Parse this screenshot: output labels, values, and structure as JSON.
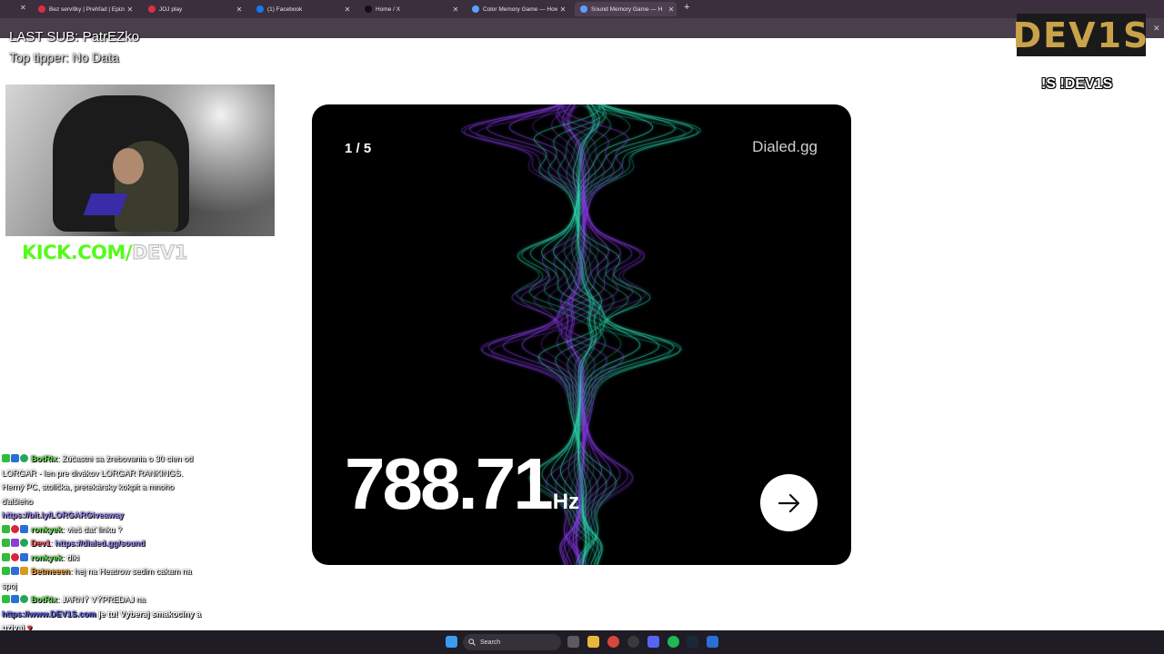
{
  "browser": {
    "tabs": [
      {
        "title": "Bez servítky | Prehľad | Epizódy",
        "color": "#d9304a"
      },
      {
        "title": "JOJ play",
        "color": "#d9304a"
      },
      {
        "title": "(1) Facebook",
        "color": "#1877f2"
      },
      {
        "title": "Home / X",
        "color": "#111111"
      },
      {
        "title": "Color Memory Game — How W",
        "color": "#5aa0ff"
      },
      {
        "title": "Sound Memory Game — H",
        "color": "#5aa0ff"
      }
    ],
    "new_tab": "+"
  },
  "overlay": {
    "last_sub": "LAST SUB: PatrEZko",
    "top_tipper": "Top tipper: No Data",
    "logo": "DEV1S",
    "command": "!S !DEV1S",
    "kick_url_green": "KICK.COM/",
    "kick_url_white": "DEV1"
  },
  "chat": {
    "messages": [
      {
        "badges": [
          "b-green",
          "b-blue",
          "b-check"
        ],
        "user": "BotRix",
        "user_class": "u-green",
        "sep": ": ",
        "text": "Zúčastni sa žrebovania o 30 cien od LORGAR - len pre divákov LORGAR RANKINGS. Herný PC, stolička, pretekársky kokpit a mnoho ďalšieho",
        "link": "https://bit.ly/LORGARGiveaway"
      },
      {
        "badges": [
          "b-green",
          "b-red",
          "b-blue"
        ],
        "user": "ronkyek",
        "user_class": "u-green",
        "sep": ": ",
        "text": "vieš dať linku ?",
        "link": ""
      },
      {
        "badges": [
          "b-green",
          "b-mic",
          "b-check"
        ],
        "user": "Dev1",
        "user_class": "u-red",
        "sep": ": ",
        "text": "",
        "link": "https://dialed.gg/sound"
      },
      {
        "badges": [
          "b-green",
          "b-red",
          "b-blue"
        ],
        "user": "ronkyek",
        "user_class": "u-green",
        "sep": ": ",
        "text": "diki",
        "link": ""
      },
      {
        "badges": [
          "b-green",
          "b-blue",
          "b-crown"
        ],
        "user": "Betmeeen",
        "user_class": "u-orange",
        "sep": ": ",
        "text": "hej na Heatrow sedim cakam na spoj",
        "link": ""
      },
      {
        "badges": [
          "b-green",
          "b-blue",
          "b-check"
        ],
        "user": "BotRix",
        "user_class": "u-green",
        "sep": ": ",
        "text": "JARNÝ VÝPREDAJ na",
        "link": ""
      }
    ],
    "tail_link": "https://www.DEV1S.com",
    "tail_text": " je tu! Vyberaj smakociny a uzivaj",
    "tail_heart": "♥"
  },
  "game": {
    "round": "1 / 5",
    "brand": "Dialed.gg",
    "frequency": "788.71",
    "unit": "Hz",
    "next_icon": "arrow-right-icon",
    "wave_colors": [
      "#2de0b8",
      "#8b3cf0"
    ]
  },
  "taskbar": {
    "search_placeholder": "Search",
    "icons": [
      "windows-start-icon",
      "task-view-icon",
      "file-explorer-icon",
      "chrome-icon",
      "obs-icon",
      "discord-icon",
      "spotify-icon",
      "steam-icon",
      "app-icon"
    ]
  }
}
